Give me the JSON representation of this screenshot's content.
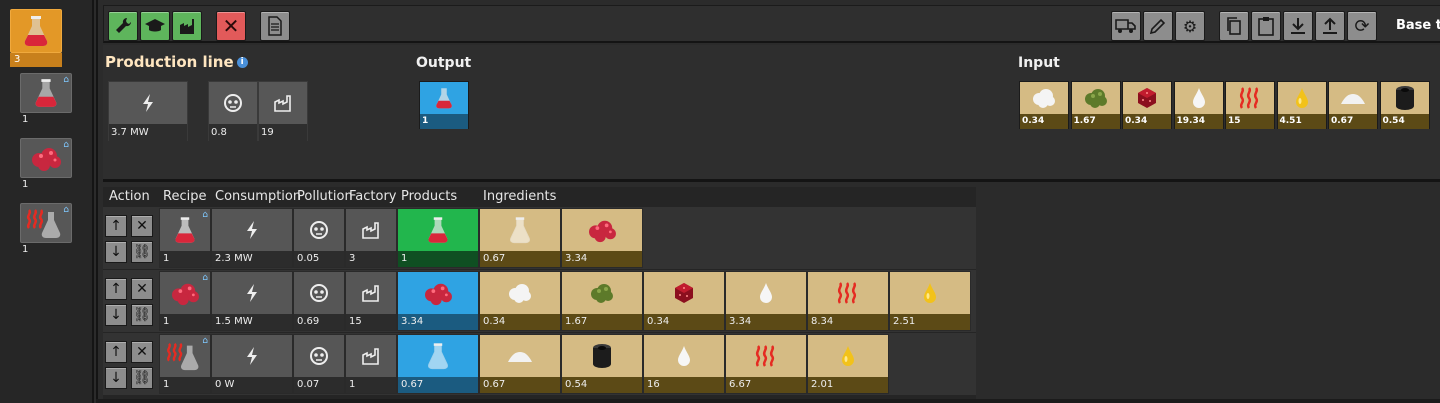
{
  "sidebar": {
    "items": [
      {
        "icon": "red-science-flask-icon",
        "count": "3",
        "active": true
      },
      {
        "icon": "red-science-flask-icon",
        "count": "1",
        "active": false
      },
      {
        "icon": "red-crystal-icon",
        "count": "1",
        "active": false
      },
      {
        "icon": "heat-flask-icon",
        "count": "1",
        "active": false
      }
    ]
  },
  "toolbar": {
    "left_buttons": [
      "wrench-icon",
      "graduation-cap-icon",
      "factory-settings-icon",
      "close-icon",
      "document-icon"
    ],
    "right_buttons": [
      "truck-icon",
      "pencil-icon",
      "gears-icon",
      "copy-icon",
      "clipboard-icon",
      "download-icon",
      "upload-icon",
      "refresh-icon"
    ],
    "base_label": "Base t"
  },
  "summary": {
    "production_title": "Production line",
    "info_glyph": "i",
    "stats": [
      {
        "icon": "power-icon",
        "value": "3.7 MW"
      },
      {
        "icon": "pollution-icon",
        "value": "0.8"
      },
      {
        "icon": "factory-icon",
        "value": "19"
      }
    ],
    "output_title": "Output",
    "outputs": [
      {
        "icon": "red-science-flask-icon",
        "value": "1"
      }
    ],
    "input_title": "Input",
    "inputs": [
      {
        "icon": "white-fluff-icon",
        "value": "0.34"
      },
      {
        "icon": "green-moss-icon",
        "value": "1.67"
      },
      {
        "icon": "red-cube-icon",
        "value": "0.34"
      },
      {
        "icon": "white-drop-icon",
        "value": "19.34"
      },
      {
        "icon": "heat-waves-icon",
        "value": "15"
      },
      {
        "icon": "yellow-drop-icon",
        "value": "4.51"
      },
      {
        "icon": "white-powder-icon",
        "value": "0.67"
      },
      {
        "icon": "black-canister-icon",
        "value": "0.54"
      }
    ]
  },
  "table": {
    "headers": [
      "Action",
      "Recipe",
      "Consumption",
      "Pollution",
      "Factory",
      "Products",
      "Ingredients"
    ],
    "rows": [
      {
        "recipe_icon": "red-science-flask-icon",
        "recipe_count": "1",
        "consumption": "2.3 MW",
        "pollution": "0.05",
        "factory": "3",
        "product": {
          "icon": "red-science-flask-icon",
          "value": "1",
          "color": "green"
        },
        "ingredients": [
          {
            "icon": "empty-flask-icon",
            "value": "0.67"
          },
          {
            "icon": "red-crystal-icon",
            "value": "3.34"
          }
        ]
      },
      {
        "recipe_icon": "red-crystal-icon",
        "recipe_count": "1",
        "consumption": "1.5 MW",
        "pollution": "0.69",
        "factory": "15",
        "product": {
          "icon": "red-crystal-icon",
          "value": "3.34",
          "color": "blue"
        },
        "ingredients": [
          {
            "icon": "white-fluff-icon",
            "value": "0.34"
          },
          {
            "icon": "green-moss-icon",
            "value": "1.67"
          },
          {
            "icon": "red-cube-icon",
            "value": "0.34"
          },
          {
            "icon": "white-drop-icon",
            "value": "3.34"
          },
          {
            "icon": "heat-waves-icon",
            "value": "8.34"
          },
          {
            "icon": "yellow-drop-icon",
            "value": "2.51"
          }
        ]
      },
      {
        "recipe_icon": "heat-flask-icon",
        "recipe_count": "1",
        "consumption": "0 W",
        "pollution": "0.07",
        "factory": "1",
        "product": {
          "icon": "empty-flask-icon",
          "value": "0.67",
          "color": "blue"
        },
        "ingredients": [
          {
            "icon": "white-powder-icon",
            "value": "0.67"
          },
          {
            "icon": "black-canister-icon",
            "value": "0.54"
          },
          {
            "icon": "white-drop-icon",
            "value": "16"
          },
          {
            "icon": "heat-waves-icon",
            "value": "6.67"
          },
          {
            "icon": "yellow-drop-icon",
            "value": "2.01"
          }
        ]
      }
    ]
  },
  "colors": {
    "accent_orange": "#e39827",
    "product_green": "#22b64d",
    "item_blue": "#2fa3e3",
    "ingredient_tan": "#d5bb84",
    "button_green": "#5eb55c",
    "button_red": "#e25a5a"
  }
}
